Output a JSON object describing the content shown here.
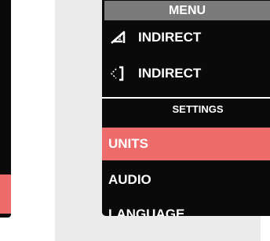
{
  "menu": {
    "title": "MENU",
    "input_items": [
      {
        "label": "INDIRECT",
        "icon": "ramp-up-icon"
      },
      {
        "label": "INDIRECT",
        "icon": "bracket-left-icon"
      }
    ],
    "section_title": "SETTINGS",
    "settings_items": [
      {
        "label": "UNITS",
        "selected": true
      },
      {
        "label": "AUDIO",
        "selected": false
      },
      {
        "label": "LANGUAGE",
        "selected": false
      }
    ]
  },
  "colors": {
    "panel_bg": "#0a0a0a",
    "header_bg": "#7a7a7a",
    "selected_bg": "#ee6b6b",
    "gray_bg": "#ebebeb"
  }
}
